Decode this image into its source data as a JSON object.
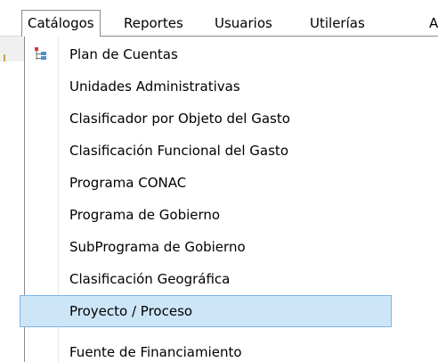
{
  "menubar": {
    "items": [
      {
        "label": "Catálogos",
        "open": true
      },
      {
        "label": "Reportes"
      },
      {
        "label": "Usuarios"
      },
      {
        "label": "Utilerías"
      },
      {
        "label": "A"
      }
    ]
  },
  "dropdown": {
    "icon": "tree-structure-icon",
    "items": [
      {
        "label": "Plan de Cuentas",
        "has_icon": true
      },
      {
        "label": "Unidades Administrativas"
      },
      {
        "label": "Clasificador por Objeto del Gasto"
      },
      {
        "label": "Clasificación Funcional del Gasto"
      },
      {
        "label": "Programa CONAC"
      },
      {
        "label": "Programa de Gobierno"
      },
      {
        "label": "SubPrograma de Gobierno"
      },
      {
        "label": "Clasificación Geográfica"
      },
      {
        "label": "Proyecto / Proceso",
        "highlighted": true
      },
      {
        "label": "Fuente de Financiamiento"
      }
    ]
  },
  "colors": {
    "highlight_bg": "#cde6f7",
    "highlight_border": "#7eb4ea",
    "menu_border": "#8c8c8c"
  }
}
